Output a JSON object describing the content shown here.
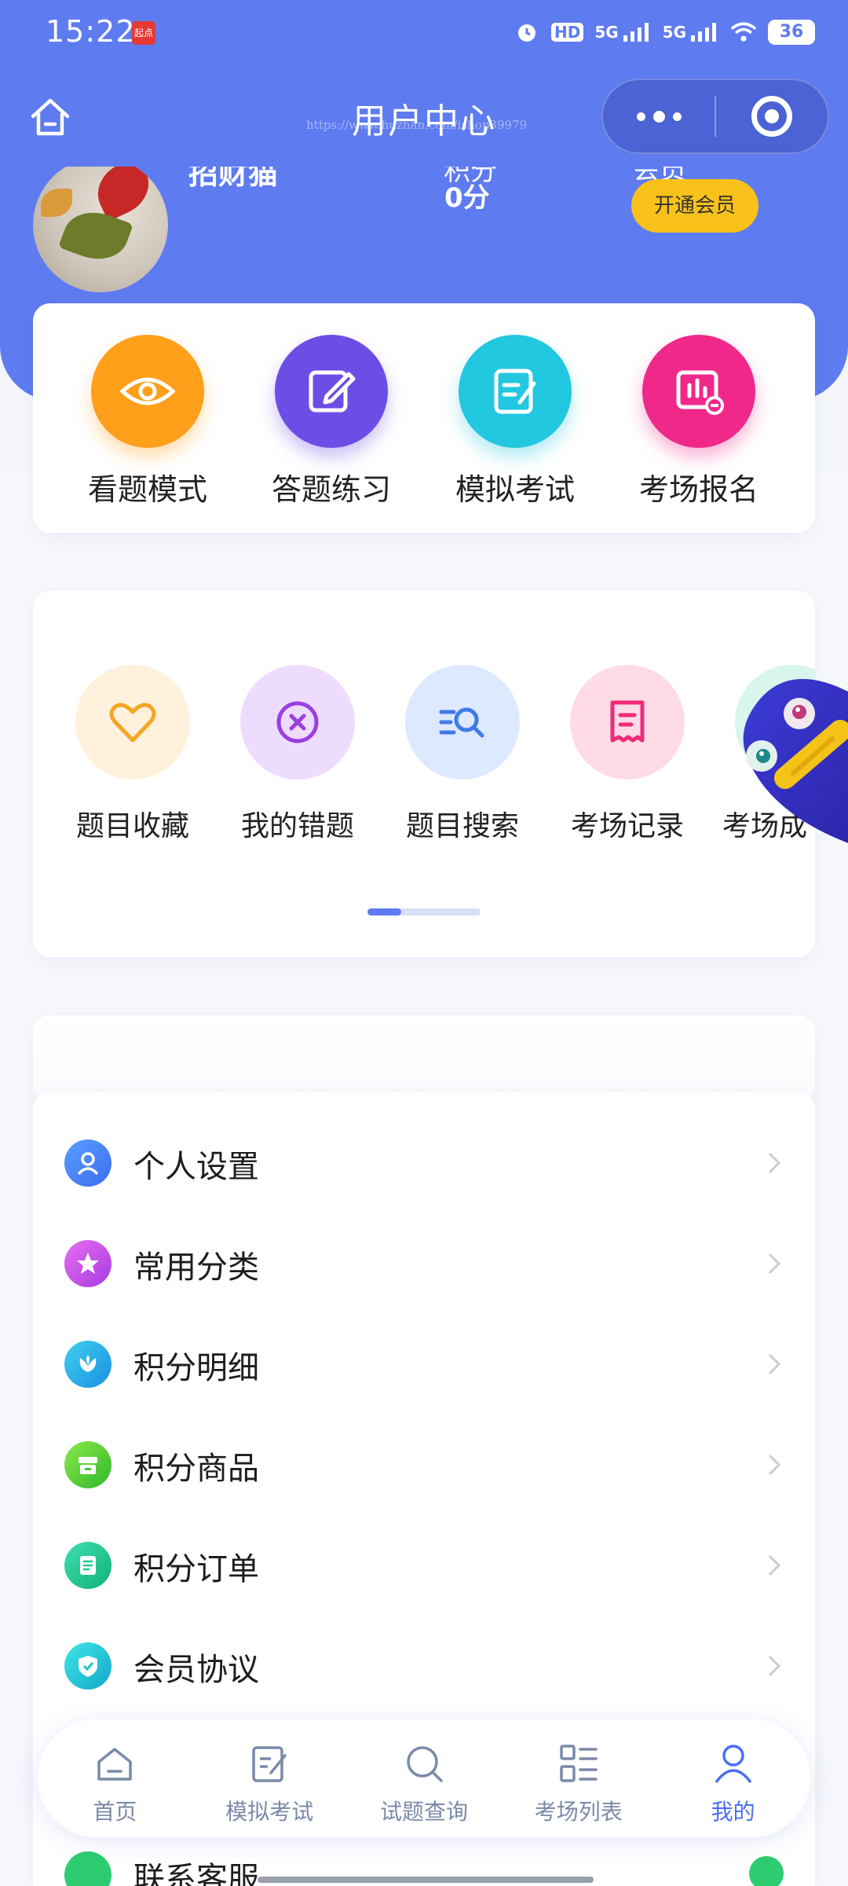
{
  "status_bar": {
    "time": "15:22",
    "app_badge": "起点",
    "hd_label": "HD",
    "signal1_label": "5G",
    "signal2_label": "5G",
    "battery": "36"
  },
  "nav": {
    "title": "用户中心",
    "watermark": "https://www.huzhan.com/ishop39979"
  },
  "profile": {
    "name": "招财猫",
    "points_label": "积分",
    "points_value": "0分",
    "member_label": "会员",
    "open_member_button": "开通会员"
  },
  "modes": [
    {
      "label": "看题模式",
      "icon": "eye-icon",
      "color": "#ff9f1a"
    },
    {
      "label": "答题练习",
      "icon": "edit-icon",
      "color": "#6c4ee6"
    },
    {
      "label": "模拟考试",
      "icon": "exam-icon",
      "color": "#22c7e0"
    },
    {
      "label": "考场报名",
      "icon": "report-icon",
      "color": "#f0288a"
    }
  ],
  "tools": [
    {
      "label": "题目收藏",
      "icon": "heart-icon",
      "bg": "#fff1dc",
      "color": "#f5a623"
    },
    {
      "label": "我的错题",
      "icon": "x-circle-icon",
      "bg": "#eedcff",
      "color": "#9b3fe0"
    },
    {
      "label": "题目搜索",
      "icon": "search-list-icon",
      "bg": "#dde9ff",
      "color": "#3f7ae8"
    },
    {
      "label": "考场记录",
      "icon": "receipt-icon",
      "bg": "#ffdbe6",
      "color": "#ef2b79"
    },
    {
      "label": "考场成",
      "icon": "score-icon",
      "bg": "#d8f5ee",
      "color": "#2bbf9c"
    }
  ],
  "tools_scroll_progress": 0.3,
  "menu": [
    {
      "label": "个人设置",
      "icon": "user-icon",
      "color": "#3b82f6"
    },
    {
      "label": "常用分类",
      "icon": "star-icon",
      "color": "#c34ee8"
    },
    {
      "label": "积分明细",
      "icon": "flower-icon",
      "color": "#1fb8e6"
    },
    {
      "label": "积分商品",
      "icon": "store-icon",
      "color": "#53d12e"
    },
    {
      "label": "积分订单",
      "icon": "order-icon",
      "color": "#17c98f"
    },
    {
      "label": "会员协议",
      "icon": "shield-icon",
      "color": "#17c9c9"
    }
  ],
  "menu_partial": {
    "label": "联系客服",
    "icon": "wechat-icon"
  },
  "tabbar": [
    {
      "label": "首页",
      "icon": "home-icon",
      "active": false
    },
    {
      "label": "模拟考试",
      "icon": "edit-icon",
      "active": false
    },
    {
      "label": "试题查询",
      "icon": "search-icon",
      "active": false
    },
    {
      "label": "考场列表",
      "icon": "list-icon",
      "active": false
    },
    {
      "label": "我的",
      "icon": "person-icon",
      "active": true
    }
  ]
}
